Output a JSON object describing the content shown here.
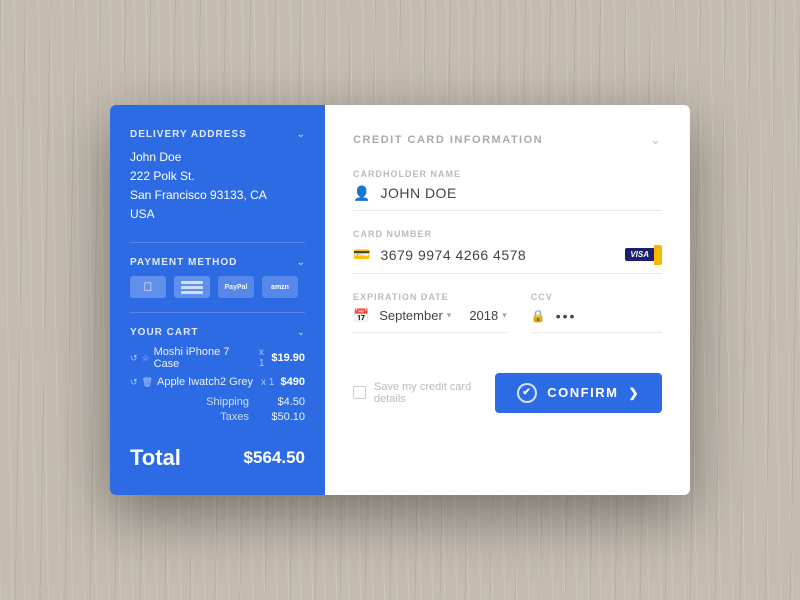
{
  "left": {
    "delivery": {
      "section_title": "DELIVERY ADDRESS",
      "name": "John Doe",
      "address": "222 Polk St.",
      "city": "San Francisco 93133, CA",
      "country": "USA"
    },
    "payment": {
      "section_title": "PAYMENT METHOD"
    },
    "cart": {
      "section_title": "YOUR CART",
      "items": [
        {
          "name": "Moshi iPhone 7 Case",
          "qty": "x 1",
          "price": "$19.90"
        },
        {
          "name": "Apple Iwatch2 Grey",
          "qty": "x 1",
          "price": "$490"
        }
      ],
      "shipping_label": "Shipping",
      "shipping_value": "$4.50",
      "taxes_label": "Taxes",
      "taxes_value": "$50.10",
      "total_label": "Total",
      "total_value": "$564.50"
    }
  },
  "right": {
    "title": "CREDIT CARD INFORMATION",
    "cardholder": {
      "label": "CARDHOLDER NAME",
      "value": "JOHN DOE"
    },
    "card_number": {
      "label": "CARD NUMBER",
      "value": "3679 9974 4266 4578",
      "card_type": "VISA"
    },
    "expiration": {
      "label": "EXPIRATION DATE",
      "month": "September",
      "year": "2018"
    },
    "ccv": {
      "label": "CCV",
      "value": "•••"
    },
    "save_label": "Save my credit card details",
    "confirm_button": "CONFIRM"
  },
  "colors": {
    "primary": "#2d6be4",
    "text_dark": "#444",
    "text_muted": "#bbb"
  }
}
